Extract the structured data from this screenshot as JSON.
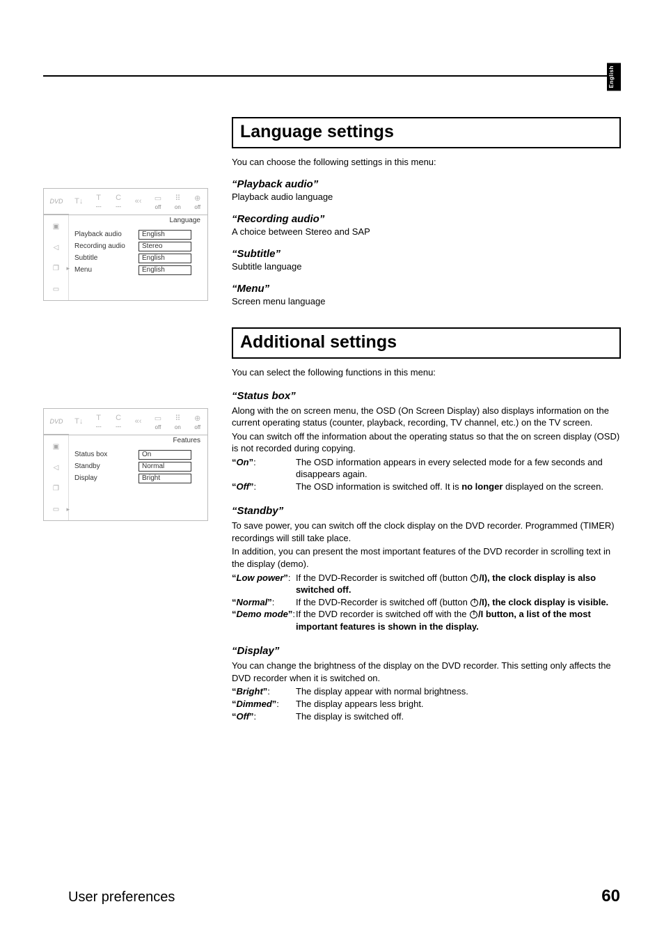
{
  "sideTab": "English",
  "footer": {
    "title": "User preferences",
    "page": "60"
  },
  "section1": {
    "title": "Language settings",
    "intro": "You can choose the following settings in this menu:",
    "items": [
      {
        "head": "Playback audio",
        "desc": "Playback audio language"
      },
      {
        "head": "Recording audio",
        "desc": "A choice between Stereo and SAP"
      },
      {
        "head": "Subtitle",
        "desc": "Subtitle language"
      },
      {
        "head": "Menu",
        "desc": "Screen menu language"
      }
    ]
  },
  "section2": {
    "title": "Additional settings",
    "intro": "You can select the following functions in this menu:",
    "statusBox": {
      "head": "Status box",
      "p1": "Along with the on screen menu, the OSD (On Screen Display) also displays information on the current operating status (counter, playback, recording, TV channel, etc.) on the TV screen.",
      "p2": "You can switch off the information about the operating status so that the on screen display (OSD) is not recorded during copying.",
      "defs": [
        {
          "term": "On",
          "def": "The OSD information appears in every selected mode for a few seconds and disappears again."
        },
        {
          "termPrefix": "Off",
          "defPrefix": "The OSD information is switched off. It is ",
          "bold": "no longer",
          "defSuffix": " displayed on the screen."
        }
      ]
    },
    "standby": {
      "head": "Standby",
      "p1": "To save power, you can switch off the clock display on the DVD recorder. Programmed (TIMER) recordings will still take place.",
      "p2": "In addition, you can present the most important features of the DVD recorder in scrolling text in the display (demo).",
      "defs": [
        {
          "term": "Low power",
          "pre": "If the DVD-Recorder is switched off (button ",
          "post": "/I), the clock display is also switched off."
        },
        {
          "term": "Normal",
          "pre": "If the DVD-Recorder is switched off (button ",
          "post": "/I), the clock display is visible."
        },
        {
          "term": "Demo mode",
          "pre": "If the DVD recorder is switched off with the ",
          "post": "/I button, a list of the most important features is shown in the display."
        }
      ]
    },
    "display": {
      "head": "Display",
      "p1": "You can change the brightness of the display on the DVD recorder. This setting only affects the DVD recorder when it is switched on.",
      "defs": [
        {
          "term": "Bright",
          "def": "The display appear with normal brightness."
        },
        {
          "term": "Dimmed",
          "def": "The display appears less bright."
        },
        {
          "term": "Off",
          "def": "The display is switched off."
        }
      ]
    }
  },
  "osd1": {
    "logo": "DVD",
    "topvals": [
      "",
      "---",
      "---",
      "",
      "",
      "off",
      "on",
      "off"
    ],
    "category": "Language",
    "rows": [
      {
        "label": "Playback audio",
        "value": "English"
      },
      {
        "label": "Recording audio",
        "value": "Stereo"
      },
      {
        "label": "Subtitle",
        "value": "English"
      },
      {
        "label": "Menu",
        "value": "English"
      }
    ]
  },
  "osd2": {
    "logo": "DVD",
    "topvals": [
      "",
      "---",
      "---",
      "",
      "",
      "off",
      "on",
      "off"
    ],
    "category": "Features",
    "rows": [
      {
        "label": "Status box",
        "value": "On"
      },
      {
        "label": "Standby",
        "value": "Normal"
      },
      {
        "label": "Display",
        "value": "Bright"
      }
    ]
  }
}
